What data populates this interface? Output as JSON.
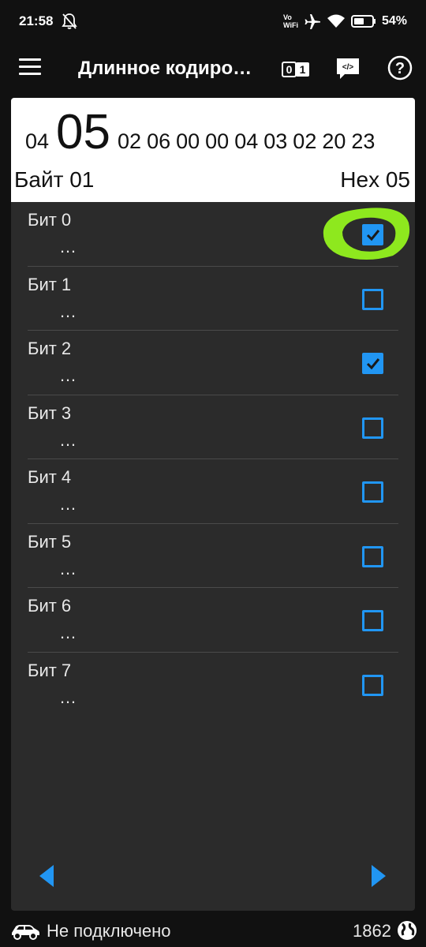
{
  "status_bar": {
    "time": "21:58",
    "vowifi_top": "Vo",
    "vowifi_bottom": "WiFi",
    "battery_pct": "54%"
  },
  "app_bar": {
    "title": "Длинное кодиро…"
  },
  "byte_header": {
    "bytes_before": [
      "04"
    ],
    "selected_byte": "05",
    "bytes_after": [
      "02",
      "06",
      "00",
      "00",
      "04",
      "03",
      "02",
      "20",
      "23"
    ],
    "byte_label": "Байт 01",
    "hex_label": "Hex 05"
  },
  "bits": [
    {
      "name": "Бит 0",
      "desc": "…",
      "checked": true,
      "highlighted": true
    },
    {
      "name": "Бит 1",
      "desc": "…",
      "checked": false,
      "highlighted": false
    },
    {
      "name": "Бит 2",
      "desc": "…",
      "checked": true,
      "highlighted": false
    },
    {
      "name": "Бит 3",
      "desc": "…",
      "checked": false,
      "highlighted": false
    },
    {
      "name": "Бит 4",
      "desc": "…",
      "checked": false,
      "highlighted": false
    },
    {
      "name": "Бит 5",
      "desc": "…",
      "checked": false,
      "highlighted": false
    },
    {
      "name": "Бит 6",
      "desc": "…",
      "checked": false,
      "highlighted": false
    },
    {
      "name": "Бит 7",
      "desc": "…",
      "checked": false,
      "highlighted": false
    }
  ],
  "bottom_bar": {
    "connection_status": "Не подключено",
    "count": "1862"
  },
  "colors": {
    "accent": "#2196f3",
    "highlight": "#8ee81e",
    "card_bg": "#2b2b2b",
    "page_bg": "#111111"
  },
  "icons": {
    "menu": "menu-icon",
    "binary": "binary-toggle-icon",
    "code": "code-icon",
    "help": "help-icon",
    "prev": "arrow-left-icon",
    "next": "arrow-right-icon"
  }
}
